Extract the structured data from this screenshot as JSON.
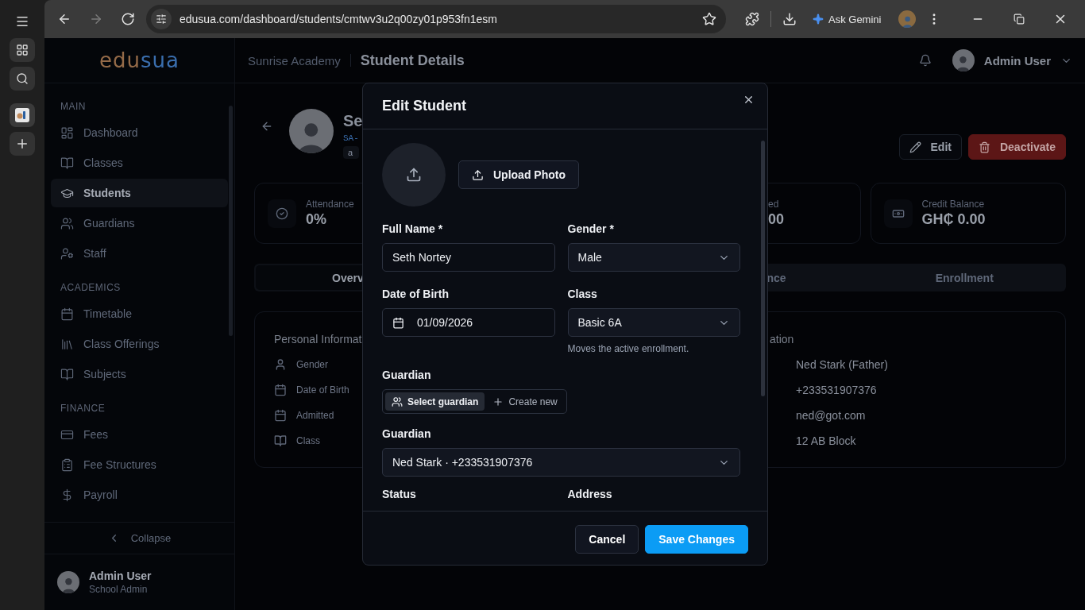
{
  "browser": {
    "nav_buttons": [
      {
        "kind": "back",
        "disabled": false
      },
      {
        "kind": "forward",
        "disabled": true
      },
      {
        "kind": "reload",
        "disabled": false
      }
    ],
    "url": "edusua.com/dashboard/students/cmtwv3u2q00zy01p953fn1esm",
    "gemini_label": "Ask Gemini"
  },
  "sidebar": {
    "logo": [
      {
        "text": "edu",
        "color": "#946a48"
      },
      {
        "text": "sua",
        "color": "#3a6eae"
      }
    ],
    "sections": [
      {
        "title": "MAIN",
        "items": [
          {
            "label": "Dashboard",
            "kind": "dashboard",
            "selected": false
          },
          {
            "label": "Classes",
            "kind": "book",
            "selected": false
          },
          {
            "label": "Students",
            "kind": "cap",
            "selected": true
          },
          {
            "label": "Guardians",
            "kind": "users",
            "selected": false
          },
          {
            "label": "Staff",
            "kind": "staff",
            "selected": false
          }
        ]
      },
      {
        "title": "ACADEMICS",
        "items": [
          {
            "label": "Timetable",
            "kind": "calendar",
            "selected": false
          },
          {
            "label": "Class Offerings",
            "kind": "library",
            "selected": false
          },
          {
            "label": "Subjects",
            "kind": "book",
            "selected": false
          }
        ]
      },
      {
        "title": "FINANCE",
        "items": [
          {
            "label": "Fees",
            "kind": "card",
            "selected": false
          },
          {
            "label": "Fee Structures",
            "kind": "clipboard",
            "selected": false
          },
          {
            "label": "Payroll",
            "kind": "dollar",
            "selected": false
          }
        ]
      }
    ],
    "collapse_label": "Collapse",
    "user": {
      "name": "Admin User",
      "role": "School Admin"
    }
  },
  "header": {
    "school": "Sunrise Academy",
    "page_title": "Student Details",
    "user_name": "Admin User"
  },
  "profile": {
    "name": "Se",
    "student_id": "SA-",
    "badge": "a",
    "actions": [
      {
        "label": "Edit",
        "kind": "edit"
      },
      {
        "label": "Deactivate",
        "kind": "danger"
      }
    ]
  },
  "stats": [
    {
      "label": "Attendance",
      "value": "0%",
      "kind": "attendance"
    },
    {
      "label": "ed",
      "value": "00",
      "kind": "cut"
    },
    {
      "label": "Credit Balance",
      "value": "GH₵ 0.00",
      "kind": "credit"
    }
  ],
  "tabs": [
    {
      "label": "Overv",
      "selected": true
    },
    {
      "label": "nce",
      "selected": false
    },
    {
      "label": "Enrollment",
      "selected": false
    }
  ],
  "info": {
    "left_title": "Personal Informat",
    "left_rows": [
      {
        "label": "Gender",
        "kind": "user"
      },
      {
        "label": "Date of Birth",
        "kind": "calendar"
      },
      {
        "label": "Admitted",
        "kind": "calendar"
      },
      {
        "label": "Class",
        "kind": "book"
      }
    ],
    "right_title": "ation",
    "right_values": [
      "Ned Stark (Father)",
      "+233531907376",
      "ned@got.com",
      "12 AB Block"
    ]
  },
  "modal": {
    "title": "Edit Student",
    "upload_label": "Upload Photo",
    "full_name": {
      "label": "Full Name *",
      "value": "Seth Nortey"
    },
    "gender": {
      "label": "Gender *",
      "value": "Male"
    },
    "dob": {
      "label": "Date of Birth",
      "value": "01/09/2026"
    },
    "class": {
      "label": "Class",
      "value": "Basic 6A",
      "hint": "Moves the active enrollment."
    },
    "guardian_mode": {
      "label": "Guardian",
      "options": [
        {
          "label": "Select guardian",
          "kind": "select",
          "selected": true
        },
        {
          "label": "Create new",
          "kind": "create",
          "selected": false
        }
      ]
    },
    "guardian": {
      "label": "Guardian",
      "value": "Ned Stark · +233531907376"
    },
    "status_label": "Status",
    "address_label": "Address",
    "cancel_label": "Cancel",
    "save_label": "Save Changes"
  }
}
